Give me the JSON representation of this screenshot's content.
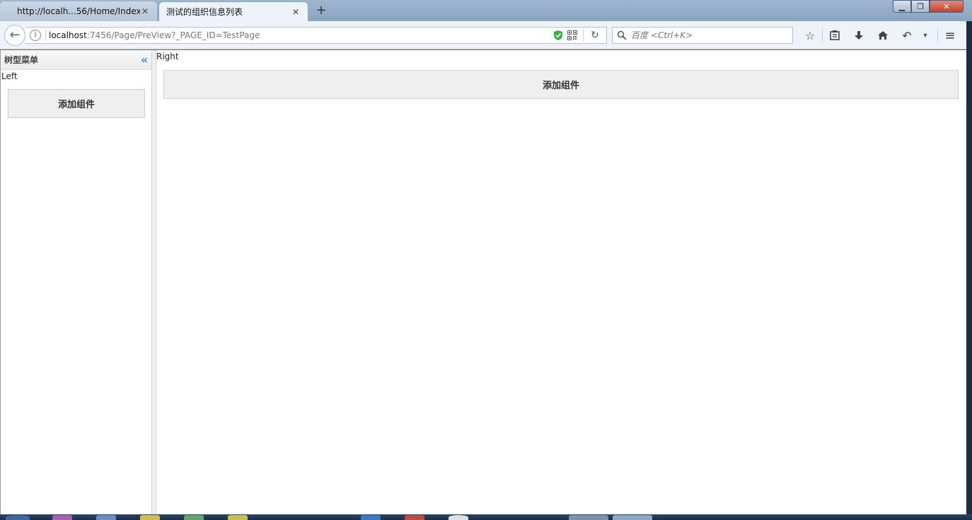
{
  "browser": {
    "tabs": [
      {
        "label": "http://localh...56/Home/Index",
        "active": false
      },
      {
        "label": "测试的组织信息列表",
        "active": true
      }
    ],
    "new_tab": "+",
    "window_controls": {
      "minimize": "▁",
      "maximize": "❐",
      "close": "✕"
    },
    "url": {
      "host": "localhost",
      "path": ":7456/Page/PreView?_PAGE_ID=TestPage"
    },
    "search_placeholder": "百度 <Ctrl+K>",
    "icons": [
      "back-arrow-icon",
      "info-icon",
      "shield-icon",
      "qr-code-icon",
      "reload-icon",
      "search-icon",
      "bookmark-star-icon",
      "reading-list-icon",
      "download-icon",
      "home-icon",
      "undo-icon",
      "dropdown-icon",
      "menu-icon"
    ]
  },
  "page": {
    "left_panel": {
      "title": "树型菜单",
      "label": "Left",
      "add_button": "添加组件"
    },
    "right_panel": {
      "label": "Right",
      "add_button": "添加组件"
    }
  },
  "colors": {
    "tab_active_bg": "#eef3f9",
    "accent_collapse": "#3a8ad6",
    "button_bg": "#efefef"
  }
}
